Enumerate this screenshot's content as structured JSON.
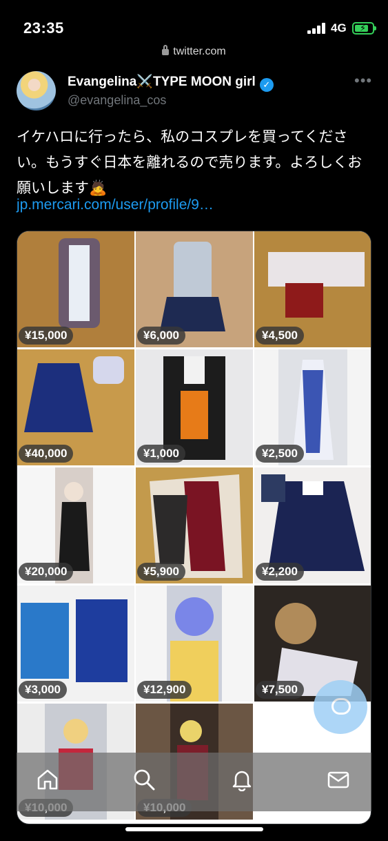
{
  "status_bar": {
    "time": "23:35",
    "network": "4G"
  },
  "browser": {
    "url": "twitter.com"
  },
  "author": {
    "display_name": "Evangelina⚔️TYPE MOON girl",
    "handle": "@evangelina_cos"
  },
  "tweet": {
    "text": "イケハロに行ったら、私のコスプレを買ってください。もうすぐ日本を離れるので売ります。よろしくお願いします🙇",
    "link": "jp.mercari.com/user/profile/9…"
  },
  "items": [
    {
      "price": "¥15,000",
      "color": "#b07f3c"
    },
    {
      "price": "¥6,000",
      "color": "#c7a37c"
    },
    {
      "price": "¥4,500",
      "color": "#b5883f"
    },
    {
      "price": "¥40,000",
      "color": "#c89a4b"
    },
    {
      "price": "¥1,000",
      "color": "#e8e8ea"
    },
    {
      "price": "¥2,500",
      "color": "#f4f4f4"
    },
    {
      "price": "¥20,000",
      "color": "#f6f6f6"
    },
    {
      "price": "¥5,900",
      "color": "#c39a4c"
    },
    {
      "price": "¥2,200",
      "color": "#f1efee"
    },
    {
      "price": "¥3,000",
      "color": "#f2f2f2"
    },
    {
      "price": "¥12,900",
      "color": "#f5f5f5"
    },
    {
      "price": "¥7,500",
      "color": "#3a2f2a"
    },
    {
      "price": "¥10,000",
      "color": "#ececec"
    },
    {
      "price": "¥10,000",
      "color": "#5a4636"
    }
  ],
  "tabs": [
    {
      "icon": "home-icon"
    },
    {
      "icon": "search-icon"
    },
    {
      "icon": "bell-icon"
    },
    {
      "icon": "mail-icon"
    }
  ],
  "colors": {
    "accent": "#1d9bf0",
    "battery": "#35d05a"
  }
}
